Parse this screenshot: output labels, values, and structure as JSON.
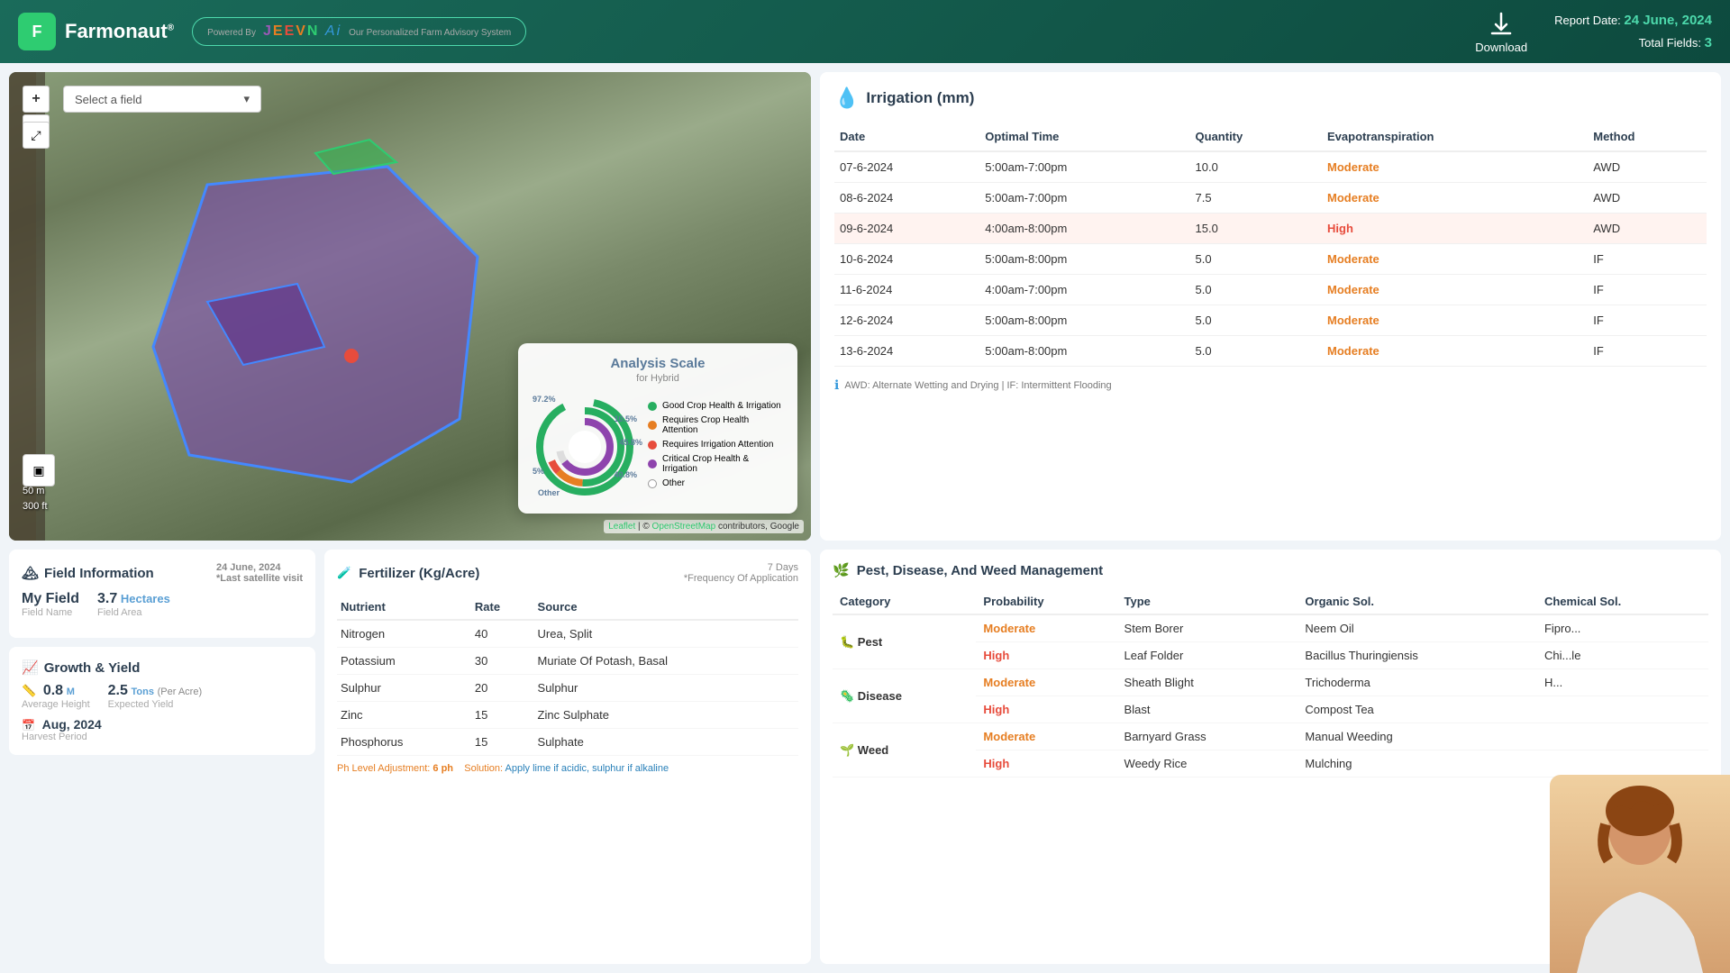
{
  "header": {
    "logo_letter": "F",
    "app_name": "Farmonaut",
    "app_name_sup": "®",
    "jeevn_name": "JEEVNAi",
    "jeevn_powered": "Powered By",
    "jeevn_tagline": "Our Personalized Farm Advisory System",
    "download_label": "Download",
    "report_date_label": "Report Date:",
    "report_date_val": "24 June, 2024",
    "total_fields_label": "Total Fields:",
    "total_fields_val": "3"
  },
  "map": {
    "field_select_placeholder": "Select a field",
    "zoom_in": "+",
    "zoom_out": "−",
    "scale_50m": "50 m",
    "scale_300ft": "300 ft",
    "attribution_leaflet": "Leaflet",
    "attribution_osm": "OpenStreetMap",
    "attribution_rest": "contributors, Google"
  },
  "analysis_scale": {
    "title": "Analysis Scale",
    "subtitle": "for Hybrid",
    "percent_97": "97.2%",
    "percent_105": "10.5%",
    "percent_458": "45.8%",
    "percent_5": "5%",
    "percent_408": "40.8%",
    "other_label": "Other",
    "legend": [
      {
        "label": "Good Crop Health & Irrigation",
        "color": "#27ae60"
      },
      {
        "label": "Requires Crop Health Attention",
        "color": "#e67e22"
      },
      {
        "label": "Requires Irrigation Attention",
        "color": "#e74c3c"
      },
      {
        "label": "Critical Crop Health & Irrigation",
        "color": "#8e44ad"
      },
      {
        "label": "Other",
        "color": "#ffffff",
        "border": true
      }
    ]
  },
  "irrigation": {
    "title": "Irrigation (mm)",
    "title_icon": "💧",
    "columns": [
      "Date",
      "Optimal Time",
      "Quantity",
      "Evapotranspiration",
      "Method"
    ],
    "rows": [
      {
        "date": "07-6-2024",
        "time": "5:00am-7:00pm",
        "qty": "10.0",
        "evap": "Moderate",
        "method": "AWD",
        "highlight": false
      },
      {
        "date": "08-6-2024",
        "time": "5:00am-7:00pm",
        "qty": "7.5",
        "evap": "Moderate",
        "method": "AWD",
        "highlight": false
      },
      {
        "date": "09-6-2024",
        "time": "4:00am-8:00pm",
        "qty": "15.0",
        "evap": "High",
        "method": "AWD",
        "highlight": true
      },
      {
        "date": "10-6-2024",
        "time": "5:00am-8:00pm",
        "qty": "5.0",
        "evap": "Moderate",
        "method": "IF",
        "highlight": false
      },
      {
        "date": "11-6-2024",
        "time": "4:00am-7:00pm",
        "qty": "5.0",
        "evap": "Moderate",
        "method": "IF",
        "highlight": false
      },
      {
        "date": "12-6-2024",
        "time": "5:00am-8:00pm",
        "qty": "5.0",
        "evap": "Moderate",
        "method": "IF",
        "highlight": false
      },
      {
        "date": "13-6-2024",
        "time": "5:00am-8:00pm",
        "qty": "5.0",
        "evap": "Moderate",
        "method": "IF",
        "highlight": false
      }
    ],
    "note": "AWD: Alternate Wetting and Drying | IF: Intermittent Flooding"
  },
  "field_info": {
    "title": "Field Information",
    "title_icon": "🏔",
    "date": "24 June, 2024",
    "date_sub": "*Last satellite visit",
    "field_name": "My Field",
    "field_name_sub": "Field Name",
    "field_area_val": "3.7",
    "field_area_unit": "Hectares",
    "field_area_sub": "Field Area"
  },
  "growth": {
    "title": "Growth & Yield",
    "title_icon": "📈",
    "height_val": "0.8",
    "height_unit": "M",
    "height_sub": "Average Height",
    "yield_val": "2.5",
    "yield_unit": "Tons",
    "yield_per": "(Per Acre)",
    "yield_sub": "Expected Yield",
    "harvest_val": "Aug, 2024",
    "harvest_sub": "Harvest Period"
  },
  "fertilizer": {
    "title": "Fertilizer (Kg/Acre)",
    "title_icon": "🧪",
    "days_label": "7 Days",
    "days_sub": "*Frequency Of Application",
    "columns": [
      "Nutrient",
      "Rate",
      "Source"
    ],
    "rows": [
      {
        "nutrient": "Nitrogen",
        "rate": "40",
        "source": "Urea, Split"
      },
      {
        "nutrient": "Potassium",
        "rate": "30",
        "source": "Muriate Of Potash, Basal"
      },
      {
        "nutrient": "Sulphur",
        "rate": "20",
        "source": "Sulphur"
      },
      {
        "nutrient": "Zinc",
        "rate": "15",
        "source": "Zinc Sulphate"
      },
      {
        "nutrient": "Phosphorus",
        "rate": "15",
        "source": "Sulphate"
      }
    ],
    "ph_label": "Ph Level Adjustment:",
    "ph_val": "6 ph",
    "solution_label": "Solution:",
    "solution_val": "Apply lime if acidic, sulphur if alkaline"
  },
  "pest": {
    "title": "Pest, Disease, And Weed Management",
    "title_icon": "🌿",
    "columns": [
      "Category",
      "Probability",
      "Type",
      "Organic Sol.",
      "Chemical Sol."
    ],
    "rows": [
      {
        "category": "Pest",
        "category_icon": "🐛",
        "probability": "Moderate",
        "type": "Stem Borer",
        "organic": "Neem Oil",
        "chemical": "Fipro...",
        "cat_rowspan": 2
      },
      {
        "category": "",
        "probability": "High",
        "type": "Leaf Folder",
        "organic": "Bacillus Thuringiensis",
        "chemical": "Chi...le",
        "cat_rowspan": 0
      },
      {
        "category": "Disease",
        "category_icon": "🦠",
        "probability": "Moderate",
        "type": "Sheath Blight",
        "organic": "Trichoderma",
        "chemical": "H...",
        "cat_rowspan": 2
      },
      {
        "category": "",
        "probability": "High",
        "type": "Blast",
        "organic": "Compost Tea",
        "chemical": "",
        "cat_rowspan": 0
      },
      {
        "category": "Weed",
        "category_icon": "🌱",
        "probability": "Moderate",
        "type": "Barnyard Grass",
        "organic": "Manual Weeding",
        "chemical": "",
        "cat_rowspan": 2
      },
      {
        "category": "",
        "probability": "High",
        "type": "Weedy Rice",
        "organic": "Mulching",
        "chemical": "",
        "cat_rowspan": 0
      }
    ]
  },
  "colors": {
    "teal_dark": "#0d4a3e",
    "teal": "#1a6b5a",
    "green_accent": "#2ecc71",
    "orange": "#e67e22",
    "red": "#e74c3c",
    "purple": "#8e44ad",
    "blue_accent": "#5a9fd4"
  }
}
